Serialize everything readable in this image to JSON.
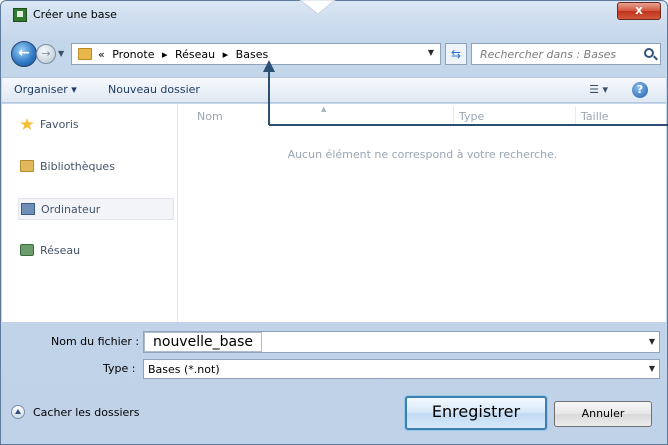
{
  "window": {
    "title": "Créer une base",
    "close_label": "x"
  },
  "address": {
    "prefix": "«",
    "crumbs": [
      "Pronote",
      "Réseau",
      "Bases"
    ],
    "separator": "▸"
  },
  "search": {
    "placeholder": "Rechercher dans : Bases"
  },
  "toolbar": {
    "organize_label": "Organiser ▾",
    "new_folder_label": "Nouveau dossier",
    "help_label": "?"
  },
  "nav_pane": {
    "items": [
      {
        "label": "Favoris",
        "icon": "star-icon"
      },
      {
        "label": "Bibliothèques",
        "icon": "library-icon"
      },
      {
        "label": "Ordinateur",
        "icon": "computer-icon"
      },
      {
        "label": "Réseau",
        "icon": "network-icon"
      }
    ]
  },
  "file_list": {
    "columns": [
      "Nom",
      "Type",
      "Taille"
    ],
    "empty_message": "Aucun élément ne correspond à votre recherche."
  },
  "fields": {
    "filename_label": "Nom du fichier :",
    "filename_value": "nouvelle_base",
    "type_label": "Type :",
    "type_value": "Bases (*.not)"
  },
  "footer": {
    "hide_folders_label": "Cacher les dossiers",
    "save_label": "Enregistrer",
    "cancel_label": "Annuler"
  },
  "colors": {
    "accent": "#2e77c4",
    "annotation": "#2c4f74"
  }
}
